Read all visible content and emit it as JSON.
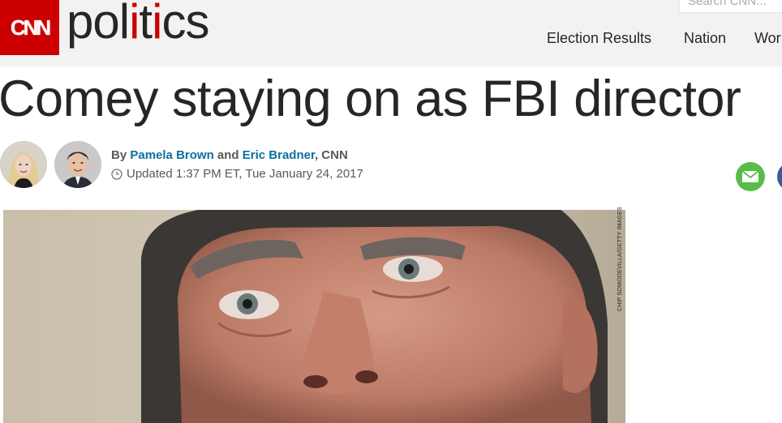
{
  "header": {
    "logo_text": "CNN",
    "section_pre": "pol",
    "section_accent": "i",
    "section_mid": "t",
    "section_accent2": "i",
    "section_post": "cs",
    "search_placeholder": "Search CNN...",
    "nav": [
      "Election Results",
      "Nation",
      "Wor"
    ]
  },
  "article": {
    "headline": "Comey staying on as FBI director",
    "byline": {
      "by": "By",
      "author1": "Pamela Brown",
      "and": "and",
      "author2": "Eric Bradner",
      "source": ", CNN"
    },
    "updated": "Updated 1:37 PM ET, Tue January 24, 2017",
    "photo_credit": "CHIP SOMODEVILLA/GETTY IMAGES"
  },
  "icons": {
    "clock": "clock-icon",
    "email": "email-icon",
    "facebook": "facebook-icon"
  },
  "colors": {
    "brand_red": "#cc0000",
    "author_link": "#0c6fa0",
    "email_green": "#5aba4a",
    "facebook_blue": "#3b5998"
  }
}
